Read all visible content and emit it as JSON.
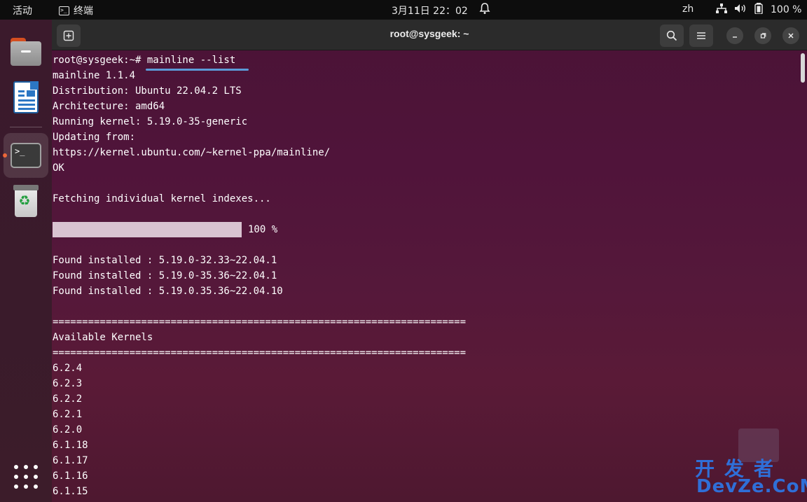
{
  "topbar": {
    "activities": "活动",
    "app_name": "终端",
    "clock": "3月11日  22：02",
    "lang": "zh",
    "battery": "100 %"
  },
  "dock": {
    "items": [
      "files",
      "libreoffice-writer",
      "terminal",
      "trash"
    ],
    "active_item": "terminal"
  },
  "window": {
    "title": "root@sysgeek: ~"
  },
  "terminal": {
    "lines": [
      "root@sysgeek:~# mainline --list",
      "mainline 1.1.4",
      "Distribution: Ubuntu 22.04.2 LTS",
      "Architecture: amd64",
      "Running kernel: 5.19.0-35-generic",
      "Updating from:",
      "https://kernel.ubuntu.com/~kernel-ppa/mainline/",
      "OK",
      "",
      "Fetching individual kernel indexes...",
      "",
      "",
      "",
      "Found installed : 5.19.0-32.33~22.04.1",
      "Found installed : 5.19.0-35.36~22.04.1",
      "Found installed : 5.19.0.35.36~22.04.10",
      "",
      "======================================================================",
      "Available Kernels",
      "======================================================================",
      "6.2.4",
      "6.2.3",
      "6.2.2",
      "6.2.1",
      "6.2.0",
      "6.1.18",
      "6.1.17",
      "6.1.16",
      "6.1.15"
    ],
    "progress_label": "100 %",
    "progress_fraction": 1.0
  },
  "watermark": {
    "top": "开发者",
    "bottom": "DevZe.CoM"
  },
  "colors": {
    "accent": "#e95420",
    "underline": "#5b9bd8",
    "watermark": "#2f6fd8"
  }
}
